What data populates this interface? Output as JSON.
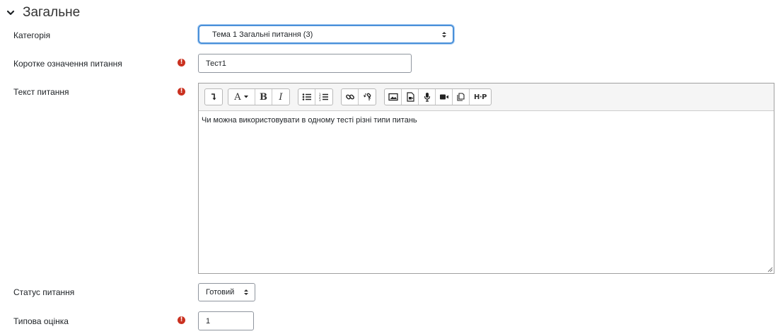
{
  "section": {
    "title": "Загальне",
    "icon": "chevron-down-icon"
  },
  "category": {
    "label": "Категорія",
    "value": "Тема 1 Загальні питання (3)"
  },
  "short_name": {
    "label": "Коротке означення питання",
    "value": "Тест1",
    "required": true
  },
  "question_text": {
    "label": "Текст питання",
    "required": true,
    "content": "Чи можна використовувати в одному тесті різні типи питань",
    "toolbar": [
      [
        "toolbar-toggle-icon"
      ],
      [
        "font-color-icon",
        "bold-icon",
        "italic-icon"
      ],
      [
        "unordered-list-icon",
        "ordered-list-icon"
      ],
      [
        "link-icon",
        "unlink-icon"
      ],
      [
        "image-icon",
        "media-icon",
        "record-audio-icon",
        "record-video-icon",
        "manage-files-icon",
        "h5p-icon"
      ]
    ]
  },
  "status": {
    "label": "Статус питання",
    "value": "Готовий"
  },
  "default_mark": {
    "label": "Типова оцінка",
    "value": "1",
    "required": true
  },
  "colors": {
    "required": "#ca3120",
    "focus": "#4a90d9"
  }
}
